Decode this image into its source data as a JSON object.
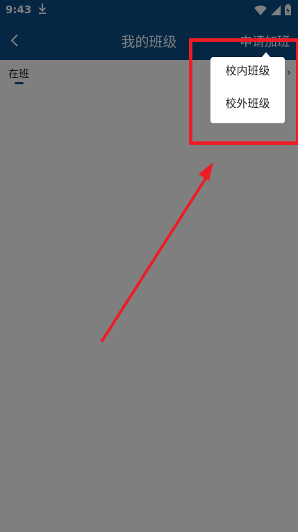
{
  "status_bar": {
    "time": "9:43",
    "download_icon": "download-icon",
    "wifi_icon": "wifi-icon",
    "signal_icon": "signal-icon",
    "battery_icon": "battery-charging-icon"
  },
  "header": {
    "title": "我的班级",
    "action_label": "申请加班",
    "back_icon": "chevron-left-icon",
    "background_color": "#0a4f88"
  },
  "tabs": {
    "current_label": "在班"
  },
  "popup_menu": {
    "items": [
      {
        "label": "校内班级"
      },
      {
        "label": "校外班级"
      }
    ]
  },
  "annotation": {
    "color": "#ee1c24"
  }
}
